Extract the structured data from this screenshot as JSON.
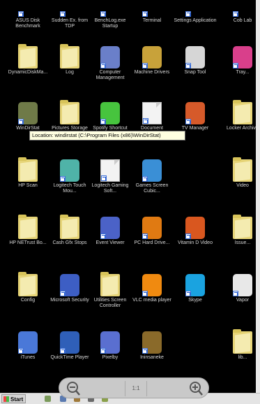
{
  "desktop": {
    "top_row": [
      {
        "label": "ASUS Disk Benchmark",
        "type": "shortcut"
      },
      {
        "label": "Sudden Ex. from TDP",
        "type": "shortcut"
      },
      {
        "label": "BenchLog.exe Startup",
        "type": "shortcut"
      },
      {
        "label": "Terminal",
        "type": "shortcut"
      },
      {
        "label": "Settings Application",
        "type": "shortcut"
      },
      {
        "label": "Cob Lab",
        "type": "shortcut"
      }
    ],
    "row1": [
      {
        "label": "DynamicDiskMa...",
        "type": "folder"
      },
      {
        "label": "Log",
        "type": "folder"
      },
      {
        "label": "Computer Management",
        "type": "app",
        "color": "#6a7fc9"
      },
      {
        "label": "Machine Drivers",
        "type": "app",
        "color": "#c8a23a"
      },
      {
        "label": "Snap Tool",
        "type": "app",
        "color": "#d6d6d6"
      },
      {
        "label": "Tray...",
        "type": "app",
        "color": "#d93f8b"
      }
    ],
    "row2": [
      {
        "label": "WinDirStat",
        "type": "app",
        "color": "#6f7a48"
      },
      {
        "label": "Pictures Storage",
        "type": "folder"
      },
      {
        "label": "Spotify Shortcut",
        "type": "app",
        "color": "#47c43e"
      },
      {
        "label": "Document",
        "type": "doc"
      },
      {
        "label": "TV Manager",
        "type": "app",
        "color": "#d65a2a"
      },
      {
        "label": "Locker Archive",
        "type": "folder"
      }
    ],
    "row3": [
      {
        "label": "HP Scan",
        "type": "folder"
      },
      {
        "label": "Logitech Touch Mou...",
        "type": "app",
        "color": "#4fb3a8"
      },
      {
        "label": "Logitech Gaming Soft...",
        "type": "doc"
      },
      {
        "label": "Games Screen Cubic...",
        "type": "app",
        "color": "#3a8fd6"
      },
      {
        "label": "",
        "type": "none"
      },
      {
        "label": "Video",
        "type": "folder"
      }
    ],
    "row4": [
      {
        "label": "HP NETrust Bo...",
        "type": "folder"
      },
      {
        "label": "Cash Gfx Stops",
        "type": "folder"
      },
      {
        "label": "Event Viewer",
        "type": "app",
        "color": "#4b62c7"
      },
      {
        "label": "PC Hard Drive...",
        "type": "app",
        "color": "#e07a12"
      },
      {
        "label": "Vitamin D Video",
        "type": "app",
        "color": "#d9571f"
      },
      {
        "label": "Issue...",
        "type": "folder"
      }
    ],
    "row5": [
      {
        "label": "Config",
        "type": "folder"
      },
      {
        "label": "Microsoft Security",
        "type": "app",
        "color": "#3d5ec4"
      },
      {
        "label": "Utilities Screen Controller",
        "type": "folder"
      },
      {
        "label": "VLC media player",
        "type": "app",
        "color": "#f08a10"
      },
      {
        "label": "Skype",
        "type": "app",
        "color": "#1aa3e0"
      },
      {
        "label": "Vapor",
        "type": "app",
        "color": "#e8e8e8"
      }
    ],
    "row6": [
      {
        "label": "iTunes",
        "type": "app",
        "color": "#4a78d8"
      },
      {
        "label": "QuickTime Player",
        "type": "app",
        "color": "#2f5fb8"
      },
      {
        "label": "Pixelby",
        "type": "app",
        "color": "#5a6fd0"
      },
      {
        "label": "Ininsaneke",
        "type": "app",
        "color": "#8a6a2a"
      },
      {
        "label": "",
        "type": "none"
      },
      {
        "label": "lib...",
        "type": "folder"
      }
    ]
  },
  "tooltip": {
    "text": "Location: windirstat (C:\\Program Files (x86)\\WinDirStat)"
  },
  "zoom": {
    "level": "1:1"
  },
  "taskbar": {
    "start_label": "Start"
  }
}
